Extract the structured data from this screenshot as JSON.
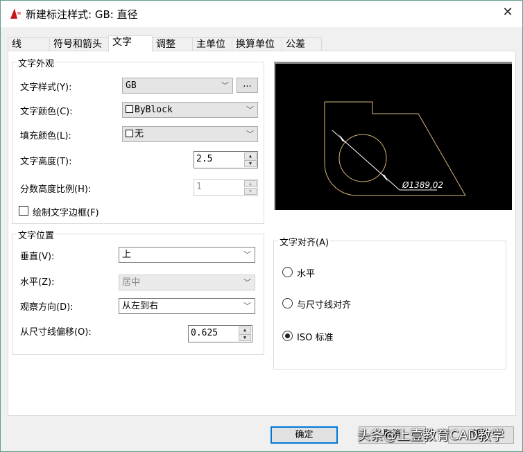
{
  "window": {
    "title": "新建标注样式: GB: 直径",
    "close_label": "✕"
  },
  "tabs": [
    {
      "label": "线"
    },
    {
      "label": "符号和箭头"
    },
    {
      "label": "文字",
      "selected": true
    },
    {
      "label": "调整"
    },
    {
      "label": "主单位"
    },
    {
      "label": "换算单位"
    },
    {
      "label": "公差"
    }
  ],
  "appearance": {
    "title": "文字外观",
    "text_style_label": "文字样式(Y):",
    "text_style_value": "GB",
    "browse_label": "...",
    "text_color_label": "文字颜色(C):",
    "text_color_value": "ByBlock",
    "fill_color_label": "填充颜色(L):",
    "fill_color_value": "无",
    "text_height_label": "文字高度(T):",
    "text_height_value": "2.5",
    "fraction_scale_label": "分数高度比例(H):",
    "fraction_scale_value": "1",
    "draw_frame_label": "绘制文字边框(F)",
    "draw_frame_checked": false
  },
  "placement": {
    "title": "文字位置",
    "vertical_label": "垂直(V):",
    "vertical_value": "上",
    "horizontal_label": "水平(Z):",
    "horizontal_value": "居中",
    "view_dir_label": "观察方向(D):",
    "view_dir_value": "从左到右",
    "offset_label": "从尺寸线偏移(O):",
    "offset_value": "0.625"
  },
  "alignment": {
    "title": "文字对齐(A)",
    "options": [
      {
        "label": "水平",
        "selected": false
      },
      {
        "label": "与尺寸线对齐",
        "selected": false
      },
      {
        "label": "ISO 标准",
        "selected": true
      }
    ]
  },
  "preview": {
    "dimension_text": "Ø1389,02",
    "geometry_color": "#d9b77a"
  },
  "buttons": {
    "ok": "确定",
    "cancel": "取消",
    "help": "帮助"
  },
  "watermark": "头条@上壹教育CAD教学"
}
